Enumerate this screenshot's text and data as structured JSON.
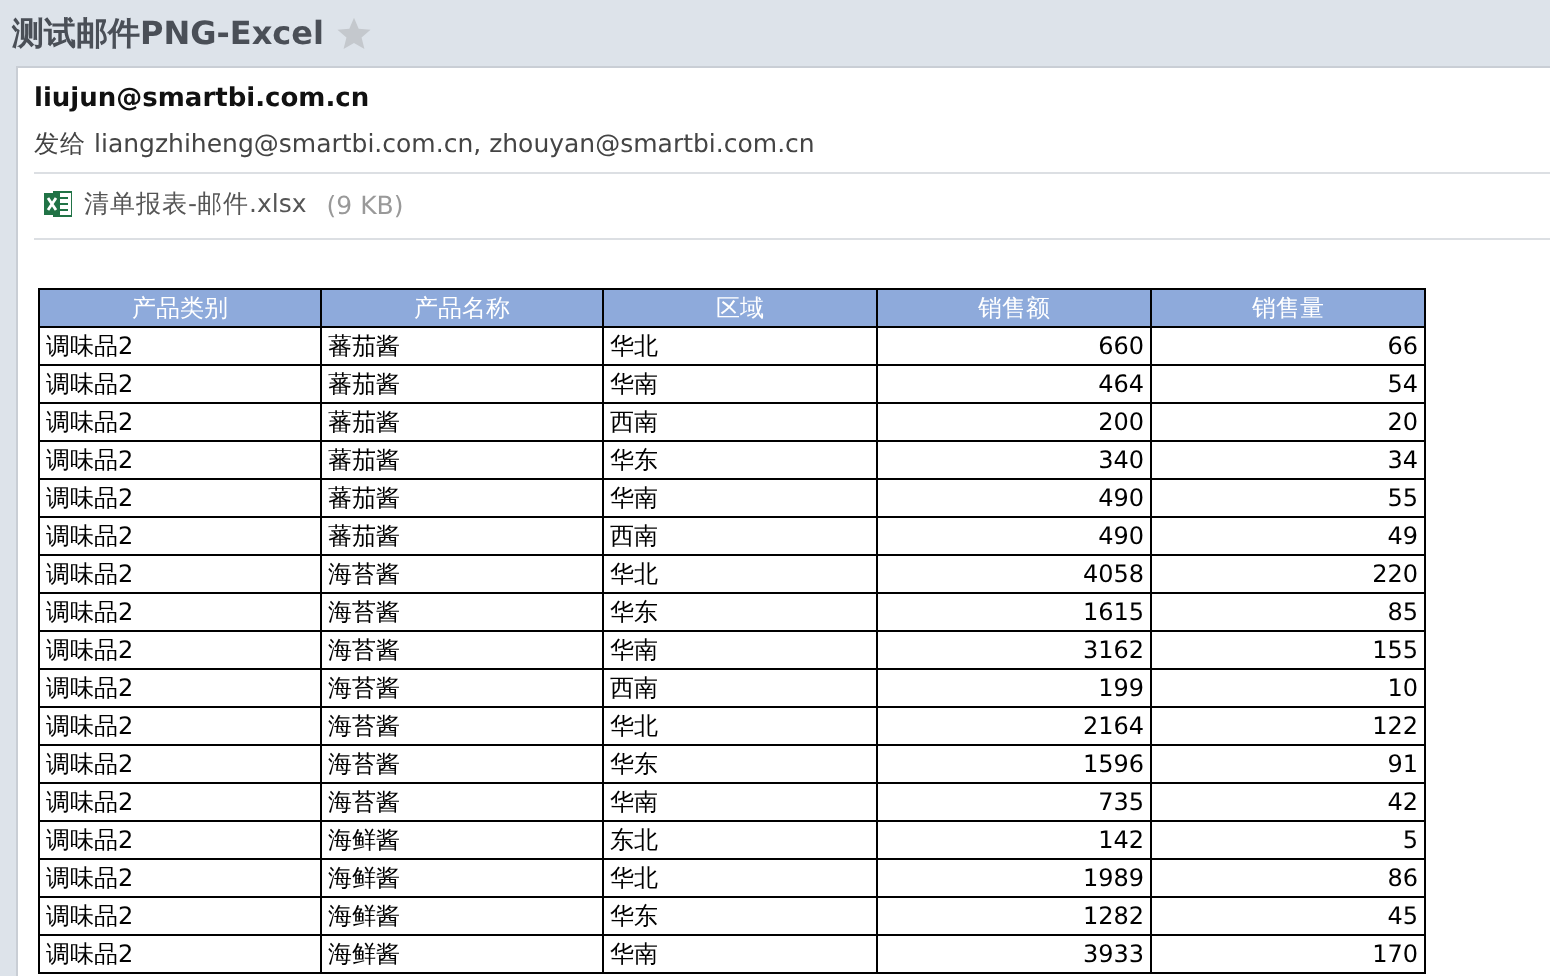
{
  "subject": {
    "title": "测试邮件PNG-Excel",
    "starred": false
  },
  "sender": "liujun@smartbi.com.cn",
  "recipients": {
    "label": "发给",
    "addresses": "liangzhiheng@smartbi.com.cn, zhouyan@smartbi.com.cn"
  },
  "attachment": {
    "name": "清单报表-邮件.xlsx",
    "size": "(9 KB)"
  },
  "table": {
    "columns": [
      {
        "label": "产品类别",
        "kind": "text"
      },
      {
        "label": "产品名称",
        "kind": "text"
      },
      {
        "label": "区域",
        "kind": "text"
      },
      {
        "label": "销售额",
        "kind": "number"
      },
      {
        "label": "销售量",
        "kind": "number"
      }
    ],
    "rows": [
      [
        "调味品2",
        "蕃茄酱",
        "华北",
        "660",
        "66"
      ],
      [
        "调味品2",
        "蕃茄酱",
        "华南",
        "464",
        "54"
      ],
      [
        "调味品2",
        "蕃茄酱",
        "西南",
        "200",
        "20"
      ],
      [
        "调味品2",
        "蕃茄酱",
        "华东",
        "340",
        "34"
      ],
      [
        "调味品2",
        "蕃茄酱",
        "华南",
        "490",
        "55"
      ],
      [
        "调味品2",
        "蕃茄酱",
        "西南",
        "490",
        "49"
      ],
      [
        "调味品2",
        "海苔酱",
        "华北",
        "4058",
        "220"
      ],
      [
        "调味品2",
        "海苔酱",
        "华东",
        "1615",
        "85"
      ],
      [
        "调味品2",
        "海苔酱",
        "华南",
        "3162",
        "155"
      ],
      [
        "调味品2",
        "海苔酱",
        "西南",
        "199",
        "10"
      ],
      [
        "调味品2",
        "海苔酱",
        "华北",
        "2164",
        "122"
      ],
      [
        "调味品2",
        "海苔酱",
        "华东",
        "1596",
        "91"
      ],
      [
        "调味品2",
        "海苔酱",
        "华南",
        "735",
        "42"
      ],
      [
        "调味品2",
        "海鲜酱",
        "东北",
        "142",
        "5"
      ],
      [
        "调味品2",
        "海鲜酱",
        "华北",
        "1989",
        "86"
      ],
      [
        "调味品2",
        "海鲜酱",
        "华东",
        "1282",
        "45"
      ],
      [
        "调味品2",
        "海鲜酱",
        "华南",
        "3933",
        "170"
      ]
    ]
  }
}
